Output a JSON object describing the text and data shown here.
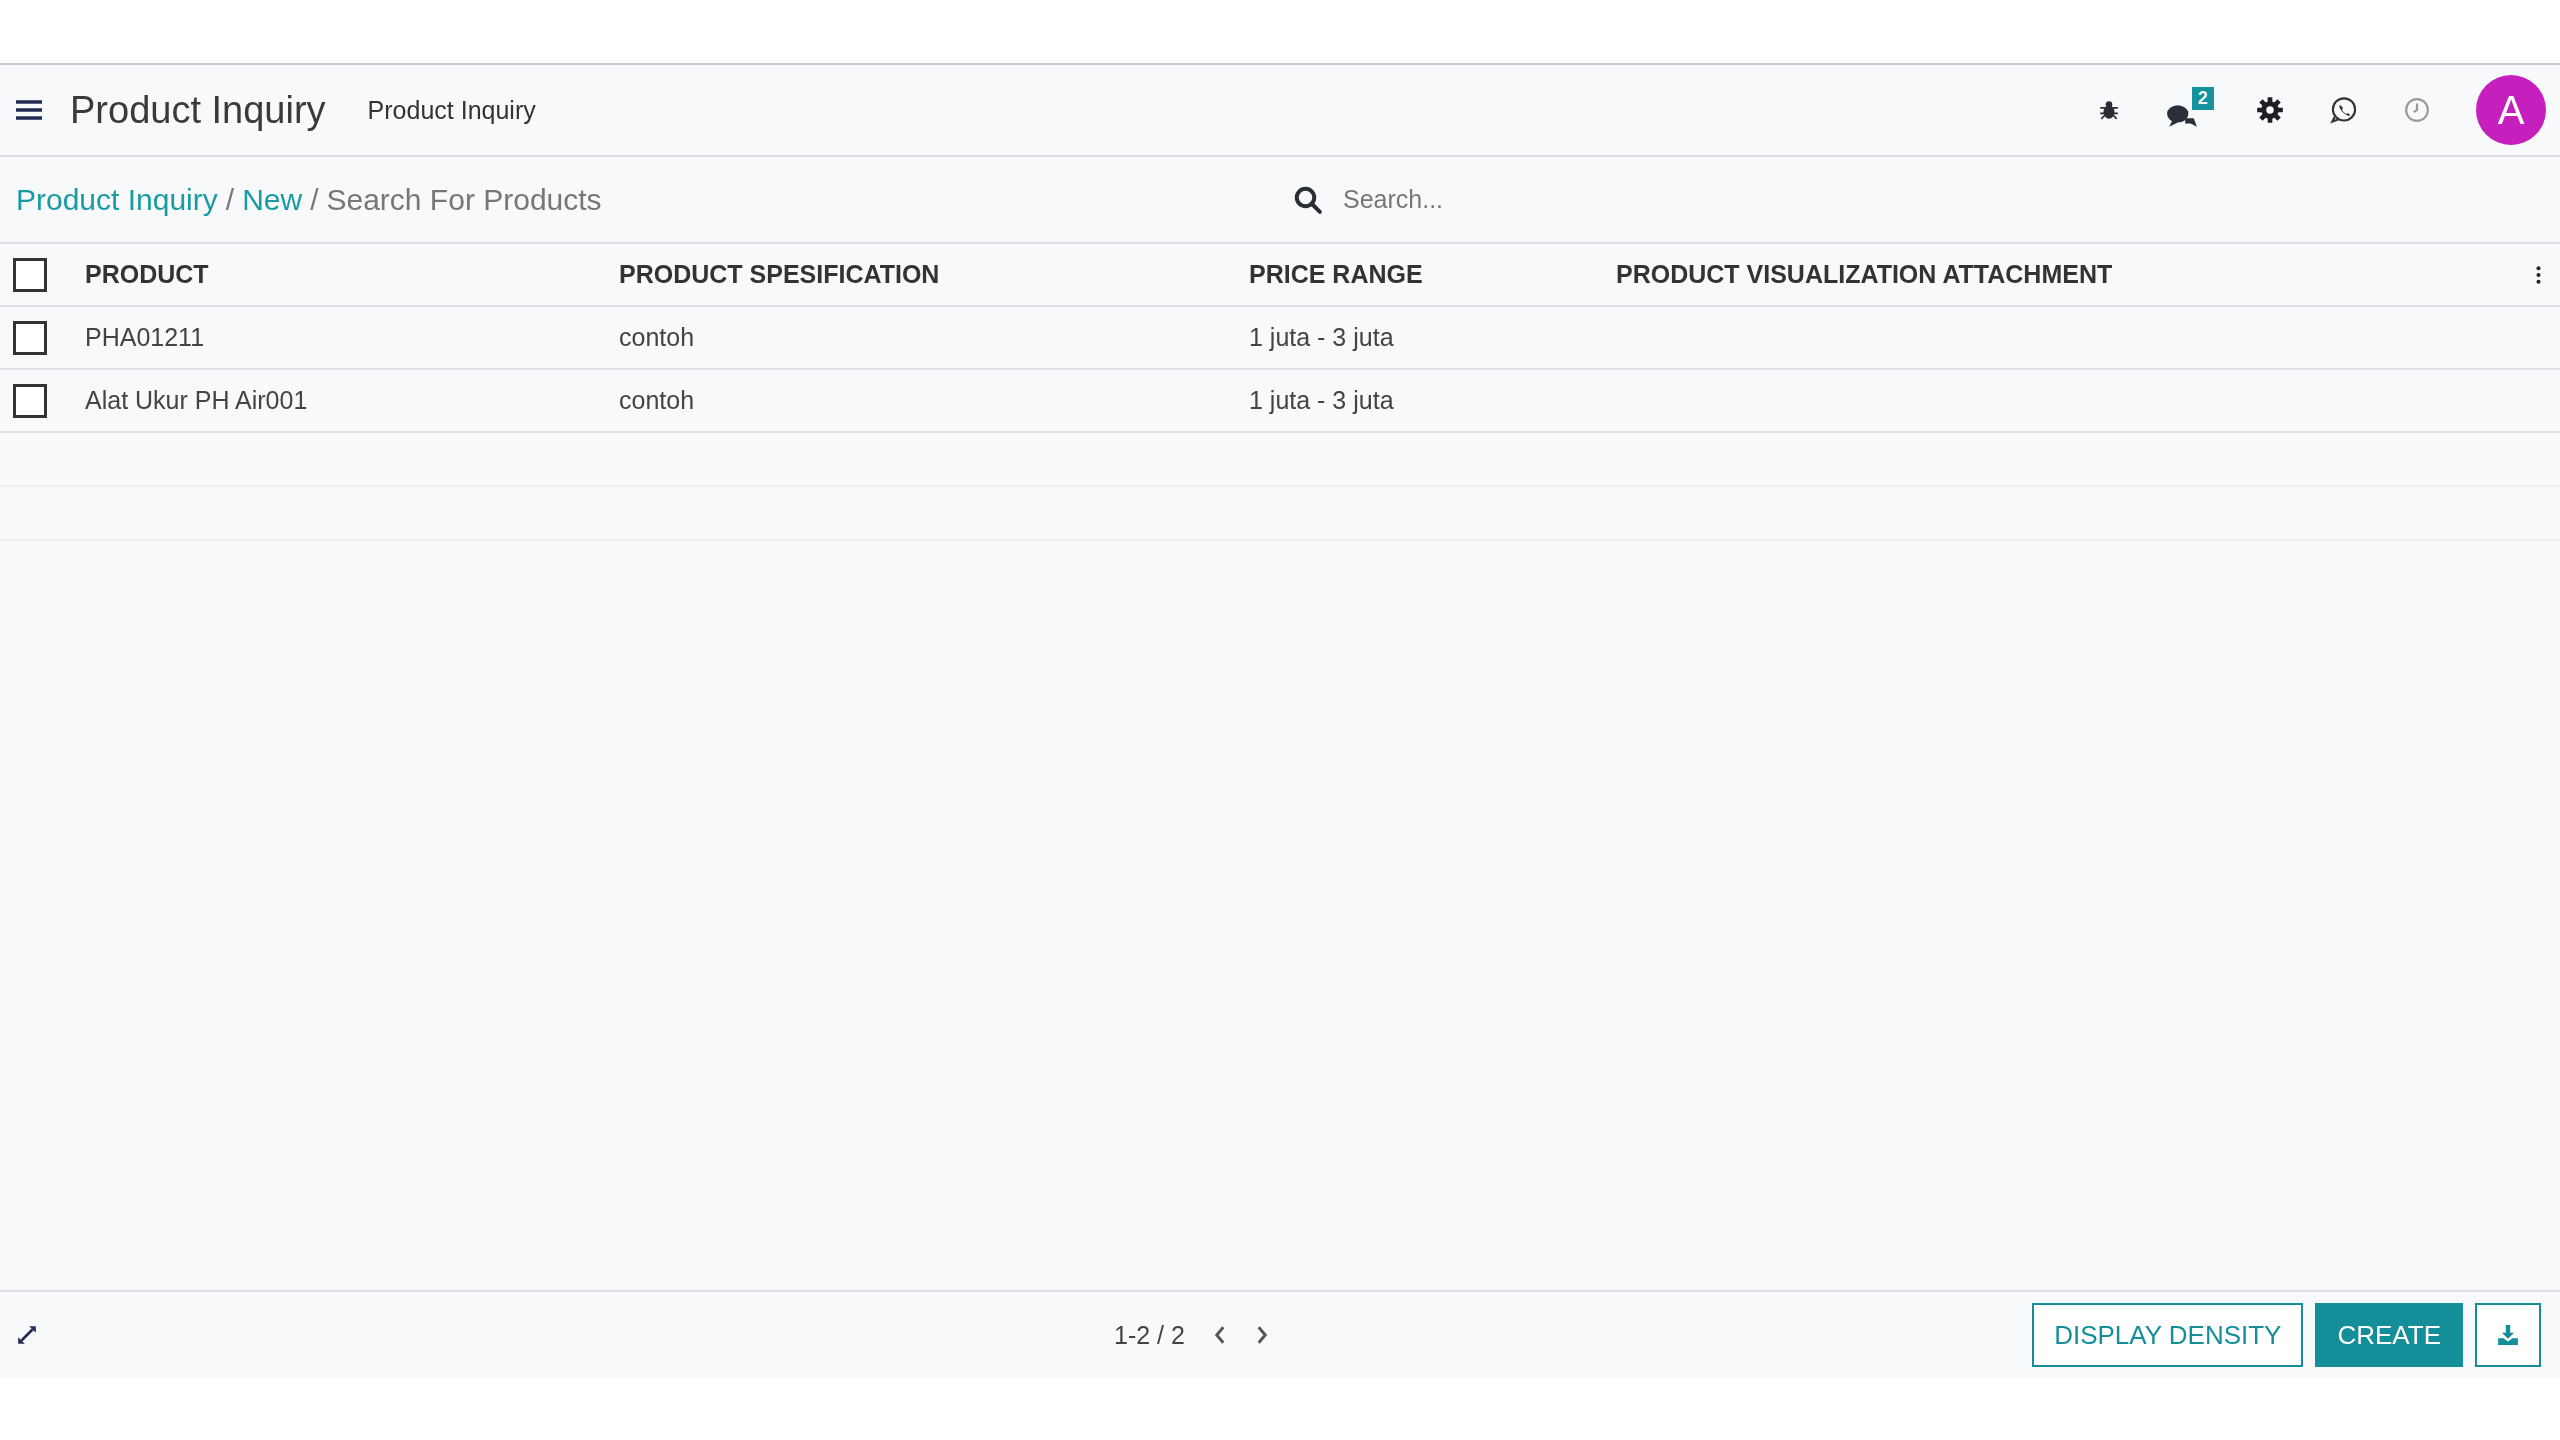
{
  "header": {
    "app_title": "Product Inquiry",
    "menu_item": "Product Inquiry",
    "message_count": "2",
    "avatar_letter": "A"
  },
  "breadcrumb": [
    {
      "label": "Product Inquiry",
      "kind": "link"
    },
    {
      "label": "/",
      "kind": "separator"
    },
    {
      "label": "New",
      "kind": "link"
    },
    {
      "label": "/",
      "kind": "separator"
    },
    {
      "label": "Search For Products",
      "kind": "current"
    }
  ],
  "search": {
    "placeholder": "Search..."
  },
  "table": {
    "select_all": {
      "checked": false
    },
    "columns": [
      "PRODUCT",
      "PRODUCT SPESIFICATION",
      "PRICE RANGE",
      "PRODUCT VISUALIZATION ATTACHMENT"
    ],
    "rows": [
      {
        "checked": false,
        "cells": [
          "PHA01211",
          "contoh",
          "1 juta - 3 juta"
        ]
      },
      {
        "checked": false,
        "cells": [
          "Alat Ukur PH Air001",
          "contoh",
          "1 juta - 3 juta"
        ]
      }
    ]
  },
  "footer": {
    "pager": "1-2 / 2",
    "buttons": [
      {
        "label": "DISPLAY DENSITY",
        "kind": "outline"
      },
      {
        "label": "CREATE",
        "kind": "primary"
      }
    ]
  }
}
